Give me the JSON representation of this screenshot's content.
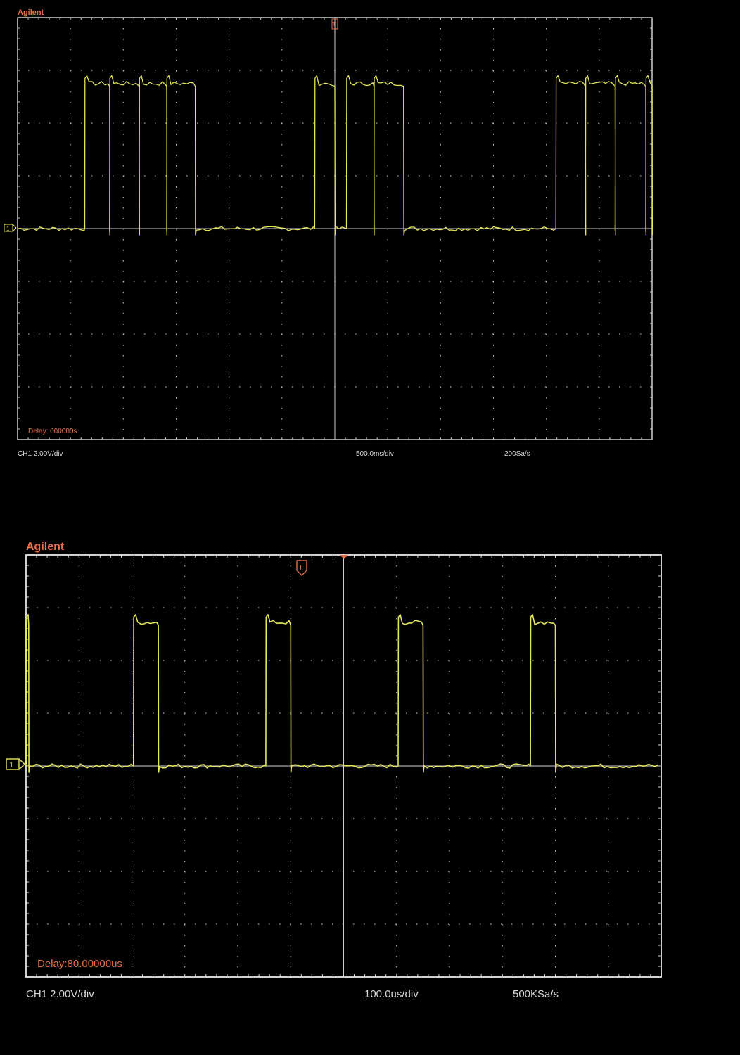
{
  "colors": {
    "background": "#000000",
    "trace": "#e6e65a",
    "graticule": "#d0d0d0",
    "brand": "#e8704a",
    "status_text": "#d8d8d8"
  },
  "scopes": [
    {
      "brand": "Agilent",
      "delay_text": "Delay:.000000s",
      "channel_scale": "CH1 2.00V/div",
      "timebase": "500.0ms/div",
      "sample_rate": "200Sa/s",
      "channel_marker": "1",
      "trigger_marker": "T"
    },
    {
      "brand": "Agilent",
      "delay_text": "Delay:80.00000us",
      "channel_scale": "CH1 2.00V/div",
      "timebase": "100.0us/div",
      "sample_rate": "500KSa/s",
      "channel_marker": "1",
      "trigger_marker": "T"
    }
  ],
  "chart_data": [
    {
      "type": "line",
      "title": "",
      "xlabel": "",
      "ylabel": "",
      "x_unit": "div",
      "y_unit": "div",
      "xlim": [
        0,
        12
      ],
      "ylim": [
        -4,
        4
      ],
      "grid": true,
      "series": [
        {
          "pulses_high_div": 2.85,
          "pulses": [
            [
              1.27,
              1.74
            ],
            [
              1.74,
              2.3
            ],
            [
              2.3,
              2.82
            ],
            [
              2.82,
              3.36
            ],
            [
              5.62,
              6.0
            ],
            [
              6.22,
              6.74
            ],
            [
              6.74,
              7.3
            ],
            [
              10.18,
              10.74
            ],
            [
              10.74,
              11.3
            ],
            [
              11.3,
              11.88
            ],
            [
              11.88,
              12.0
            ]
          ]
        }
      ]
    },
    {
      "type": "line",
      "title": "",
      "xlabel": "",
      "ylabel": "",
      "x_unit": "div",
      "y_unit": "div",
      "xlim": [
        0,
        12
      ],
      "ylim": [
        -4,
        4
      ],
      "grid": true,
      "series": [
        {
          "pulses_high_div": 2.82,
          "pulses": [
            [
              0.0,
              0.05
            ],
            [
              2.03,
              2.5
            ],
            [
              4.53,
              5.0
            ],
            [
              7.03,
              7.5
            ],
            [
              9.53,
              10.0
            ]
          ]
        }
      ]
    }
  ]
}
